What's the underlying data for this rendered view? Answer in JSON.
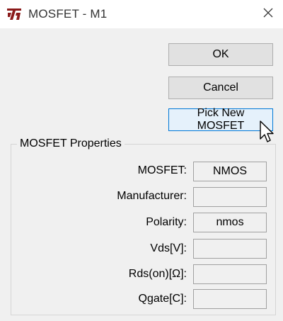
{
  "window": {
    "title": "MOSFET - M1",
    "icon": "ltspice-logo-icon",
    "close_icon": "close-icon"
  },
  "buttons": {
    "ok": "OK",
    "cancel": "Cancel",
    "pick": "Pick New MOSFET"
  },
  "properties": {
    "group_title": "MOSFET Properties",
    "rows": [
      {
        "label": "MOSFET:",
        "value": "NMOS"
      },
      {
        "label": "Manufacturer:",
        "value": ""
      },
      {
        "label": "Polarity:",
        "value": "nmos"
      },
      {
        "label": "Vds[V]:",
        "value": ""
      },
      {
        "label": "Rds(on)[Ω]:",
        "value": ""
      },
      {
        "label": "Qgate[C]:",
        "value": ""
      }
    ]
  },
  "colors": {
    "accent": "#0078d7",
    "logo": "#8b1a1a"
  }
}
